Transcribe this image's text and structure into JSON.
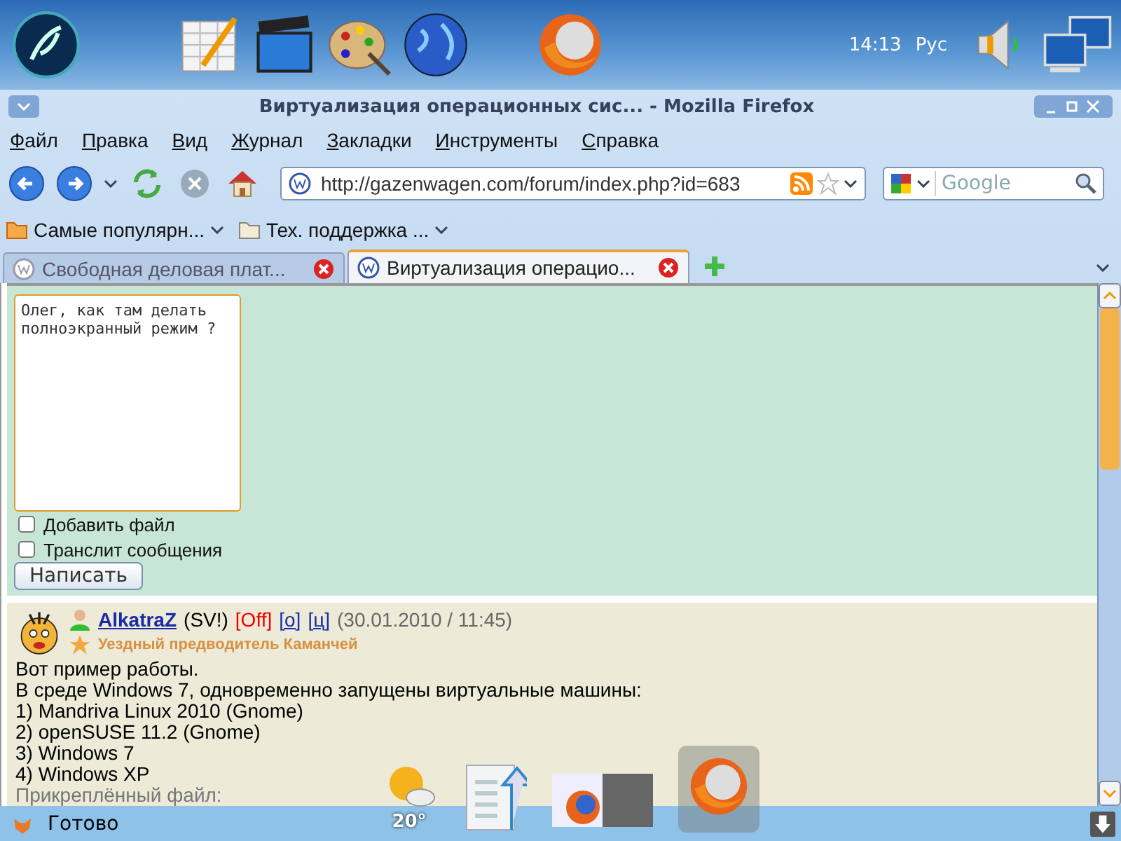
{
  "desktop_panel": {
    "clock": "14:13",
    "keyboard_layout": "Рус"
  },
  "window": {
    "title": "Виртуализация операционных сис... - Mozilla Firefox"
  },
  "menu": [
    "Файл",
    "Правка",
    "Вид",
    "Журнал",
    "Закладки",
    "Инструменты",
    "Справка"
  ],
  "navigation": {
    "url": "http://gazenwagen.com/forum/index.php?id=683",
    "search_placeholder": "Google"
  },
  "bookmarks": [
    "Самые популярн...",
    "Тех. поддержка ..."
  ],
  "tabs": [
    {
      "label": "Свободная деловая плат...",
      "selected": false
    },
    {
      "label": "Виртуализация операцио...",
      "selected": true
    }
  ],
  "reply_form": {
    "message": "Олег, как там делать полноэкранный режим ?",
    "options": [
      {
        "label": "Добавить файл",
        "checked": false
      },
      {
        "label": "Транслит сообщения",
        "checked": false
      }
    ],
    "submit": "Написать"
  },
  "post": {
    "author": "AlkatraZ",
    "tag": "(SV!)",
    "status": "[Off]",
    "links": [
      "[о]",
      "[ц]"
    ],
    "date": "(30.01.2010 / 11:45)",
    "rank": "Уездный предводитель Каманчей",
    "lines": [
      "Вот пример работы.",
      "В среде Windows 7, одновременно запущены виртуальные машины:",
      "1) Mandriva Linux 2010 (Gnome)",
      "2) openSUSE 11.2 (Gnome)",
      "3) Windows 7",
      "4) Windows XP"
    ],
    "attachment_label": "Прикреплённый файл:"
  },
  "dock": {
    "weather_temp": "20°"
  },
  "status_bar": {
    "text": "Готово"
  }
}
